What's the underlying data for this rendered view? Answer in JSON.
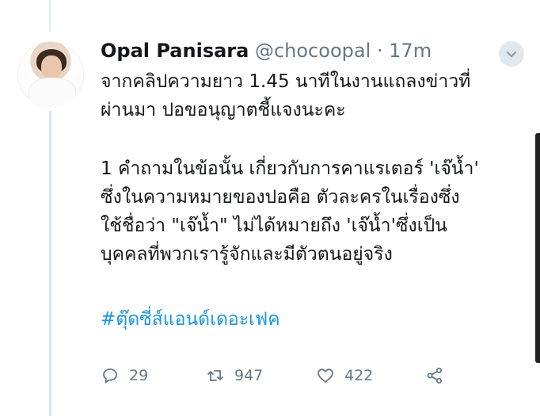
{
  "tweet": {
    "author_name": "Opal Panisara",
    "handle": "@chocoopal",
    "separator": "·",
    "time": "17m",
    "lines": [
      "จากคลิปความยาว 1.45 นาทีในงานแถลงข่าวที่",
      "ผ่านมา ปอขอนุญาตชี้แจงนะคะ",
      "1 คำถามในข้อนั้น เกี่ยวกับการคาแรเตอร์ 'เจ๊น้ำ'",
      "ซึ่งในความหมายของปอคือ ตัวละครในเรื่องซึ่ง",
      "ใช้ชื่อว่า \"เจ๊น้ำ\" ไม่ได้หมายถึง 'เจ๊น้ำ'ซึ่งเป็น",
      "บุคคลที่พวกเรารู้จักและมีตัวตนอยู่จริง"
    ],
    "hashtag": "#ตุ๊ดซี่ส์แอนด์เดอะเฟค",
    "reply_count": "29",
    "retweet_count": "947",
    "like_count": "422"
  },
  "icons": {
    "menu": "chevron-down-icon",
    "reply": "reply-icon",
    "retweet": "retweet-icon",
    "like": "heart-icon",
    "share": "share-icon"
  },
  "colors": {
    "link": "#1b95e0",
    "muted": "#657786",
    "text": "#14171a"
  }
}
